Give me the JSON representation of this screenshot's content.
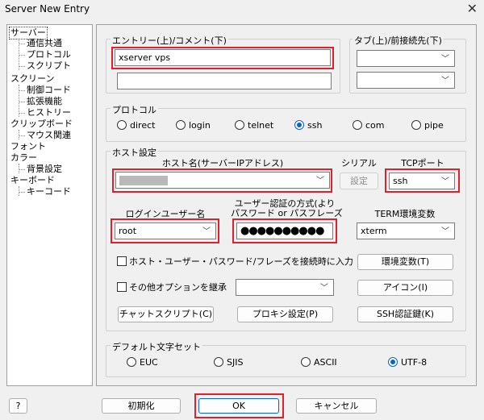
{
  "window": {
    "title": "Server New Entry",
    "close_glyph": "✕"
  },
  "tree": {
    "items": [
      {
        "label": "サーバー",
        "selected": true
      },
      {
        "label": "通信共通"
      },
      {
        "label": "プロトコル"
      },
      {
        "label": "スクリプト"
      },
      {
        "label": "スクリーン"
      },
      {
        "label": "制御コード"
      },
      {
        "label": "拡張機能"
      },
      {
        "label": "ヒストリー"
      },
      {
        "label": "クリップボード"
      },
      {
        "label": "マウス関連"
      },
      {
        "label": "フォント"
      },
      {
        "label": "カラー"
      },
      {
        "label": "背景設定"
      },
      {
        "label": "キーボード"
      },
      {
        "label": "キーコード"
      }
    ]
  },
  "entry": {
    "legend": "エントリー(上)/コメント(下)",
    "entry_value": "xserver vps",
    "comment_value": ""
  },
  "tab": {
    "legend": "タブ(上)/前接続先(下)",
    "tab_value": "",
    "prev_value": ""
  },
  "protocol": {
    "legend": "プロトコル",
    "options": [
      "direct",
      "login",
      "telnet",
      "ssh",
      "com",
      "pipe"
    ],
    "selected": "ssh"
  },
  "host": {
    "legend": "ホスト設定",
    "hostname_label": "ホスト名(サーバーIPアドレス)",
    "hostname_value": "",
    "serial_label": "シリアル",
    "serial_button": "設定",
    "tcp_label": "TCPポート",
    "tcp_value": "ssh",
    "user_label": "ログインユーザー名",
    "user_value": "root",
    "auth_label_1": "ユーザー認証の方式(より",
    "auth_label_2": "パスワード or パスフレーズ",
    "password_mask": "●●●●●●●●●●",
    "term_label": "TERM環境変数",
    "term_value": "xterm",
    "check_host_user": "ホスト・ユーザー・パスワード/フレーズを接続時に入力",
    "env_button": "環境変数(T)",
    "check_other": "その他オプションを継承",
    "other_value": "",
    "icon_button": "アイコン(I)",
    "chat_button": "チャットスクリプト(C)",
    "proxy_button": "プロキシ設定(P)",
    "ssh_button": "SSH認証鍵(K)"
  },
  "charset": {
    "legend": "デフォルト文字セット",
    "options": [
      "EUC",
      "SJIS",
      "ASCII",
      "UTF-8"
    ],
    "selected": "UTF-8"
  },
  "footer": {
    "help": "?",
    "init": "初期化",
    "ok": "OK",
    "cancel": "キャンセル"
  },
  "colors": {
    "highlight": "#e0202a",
    "accent": "#0a64c8"
  }
}
